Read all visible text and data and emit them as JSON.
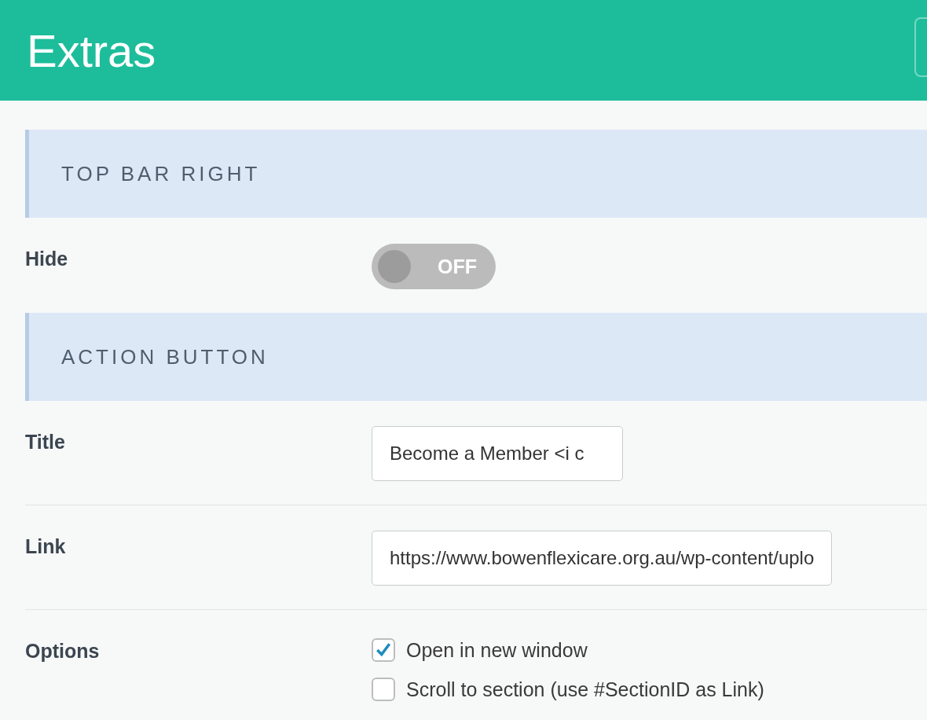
{
  "header": {
    "title": "Extras"
  },
  "sections": [
    {
      "title": "TOP BAR RIGHT",
      "fields": [
        {
          "kind": "toggle",
          "label": "Hide",
          "on": false,
          "text": "OFF"
        }
      ]
    },
    {
      "title": "ACTION BUTTON",
      "fields": [
        {
          "kind": "text",
          "label": "Title",
          "value": "Become a Member <i c"
        },
        {
          "kind": "text",
          "label": "Link",
          "value": "https://www.bowenflexicare.org.au/wp-content/uplo"
        },
        {
          "kind": "checkboxes",
          "label": "Options",
          "options": [
            {
              "label": "Open in new window",
              "checked": true
            },
            {
              "label": "Scroll to section (use #SectionID as Link)",
              "checked": false
            }
          ]
        }
      ]
    }
  ]
}
